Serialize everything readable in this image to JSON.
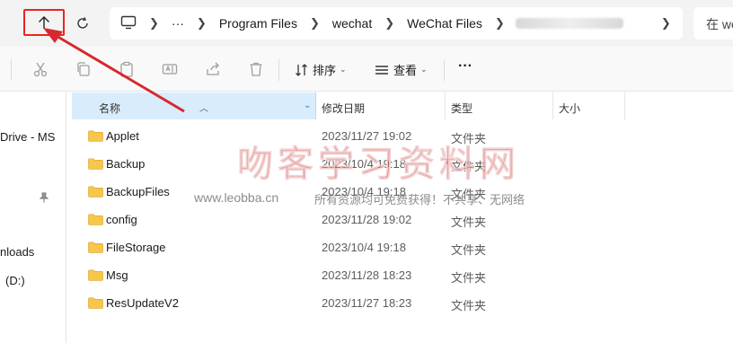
{
  "address_bar": {
    "more_label": "···",
    "crumbs": [
      "Program Files",
      "wechat",
      "WeChat Files"
    ],
    "search_placeholder": "在 wechat"
  },
  "toolbar": {
    "sort_label": "排序",
    "view_label": "查看",
    "more_label": "···"
  },
  "nav": {
    "items": [
      "Drive - MS",
      "nloads",
      "(D:)"
    ]
  },
  "columns": {
    "name": "名称",
    "modified": "修改日期",
    "type": "类型",
    "size": "大小"
  },
  "files": [
    {
      "name": "Applet",
      "modified": "2023/11/27 19:02",
      "type": "文件夹"
    },
    {
      "name": "Backup",
      "modified": "2023/10/4 19:18",
      "type": "文件夹"
    },
    {
      "name": "BackupFiles",
      "modified": "2023/10/4 19:18",
      "type": "文件夹"
    },
    {
      "name": "config",
      "modified": "2023/11/28 19:02",
      "type": "文件夹"
    },
    {
      "name": "FileStorage",
      "modified": "2023/10/4 19:18",
      "type": "文件夹"
    },
    {
      "name": "Msg",
      "modified": "2023/11/28 18:23",
      "type": "文件夹"
    },
    {
      "name": "ResUpdateV2",
      "modified": "2023/11/27 18:23",
      "type": "文件夹"
    }
  ],
  "watermark": {
    "title": "吻客学习资料网",
    "url": "www.leobba.cn",
    "note": "所有资源均可免费获得！不共享、无网络"
  },
  "colors": {
    "highlight_box": "#e8261d",
    "annotation_arrow": "#d7282f",
    "selected_column": "#d9ecfb",
    "folder": "#f7c64a"
  }
}
